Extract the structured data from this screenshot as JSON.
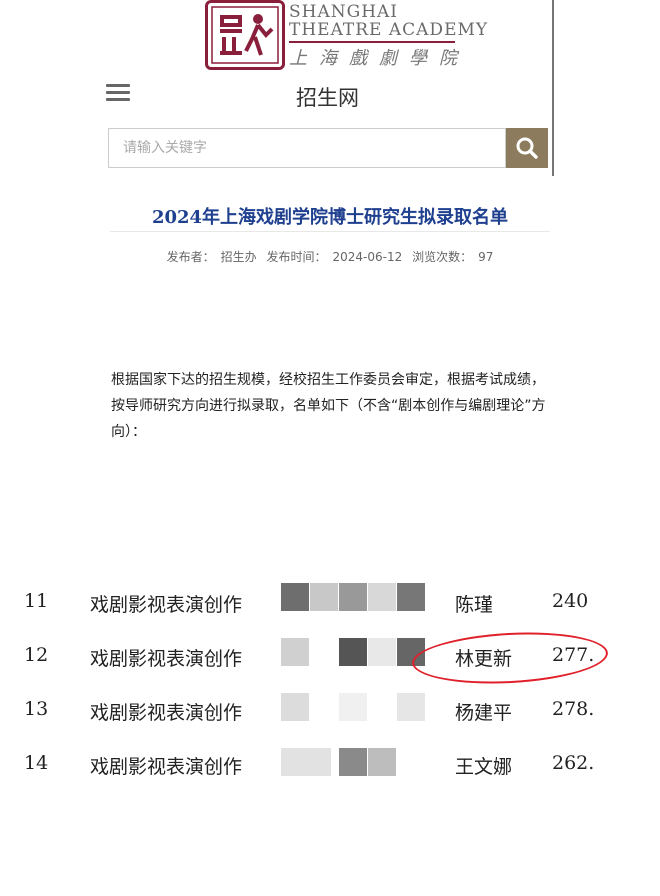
{
  "header": {
    "logo_en_line1": "SHANGHAI",
    "logo_en_line2": "THEATRE ACADEMY",
    "logo_cn": "上海戲劇學院",
    "site_title": "招生网",
    "menu_icon": "hamburger-menu-icon",
    "search_placeholder": "请输入关键字",
    "search_icon": "search-icon",
    "brand_color": "#8a1f3b",
    "search_button_color": "#8c7b5c"
  },
  "article": {
    "title": "2024年上海戏剧学院博士研究生拟录取名单",
    "title_color": "#1f3f8f",
    "publisher_label": "发布者：",
    "publisher": "招生办",
    "date_label": "发布时间：",
    "date": "2024-06-12",
    "views_label": "浏览次数：",
    "views": "97",
    "body": "根据国家下达的招生规模，经校招生工作委员会审定，根据考试成绩，按导师研究方向进行拟录取，名单如下（不含“剧本创作与编剧理论”方向）："
  },
  "table": {
    "rows": [
      {
        "no": "11",
        "direction": "戏剧影视表演创作",
        "name": "陈瑾",
        "score": "240"
      },
      {
        "no": "12",
        "direction": "戏剧影视表演创作",
        "name": "林更新",
        "score": "277."
      },
      {
        "no": "13",
        "direction": "戏剧影视表演创作",
        "name": "杨建平",
        "score": "278."
      },
      {
        "no": "14",
        "direction": "戏剧影视表演创作",
        "name": "王文娜",
        "score": "262."
      }
    ],
    "highlight_color": "#e0202a"
  }
}
